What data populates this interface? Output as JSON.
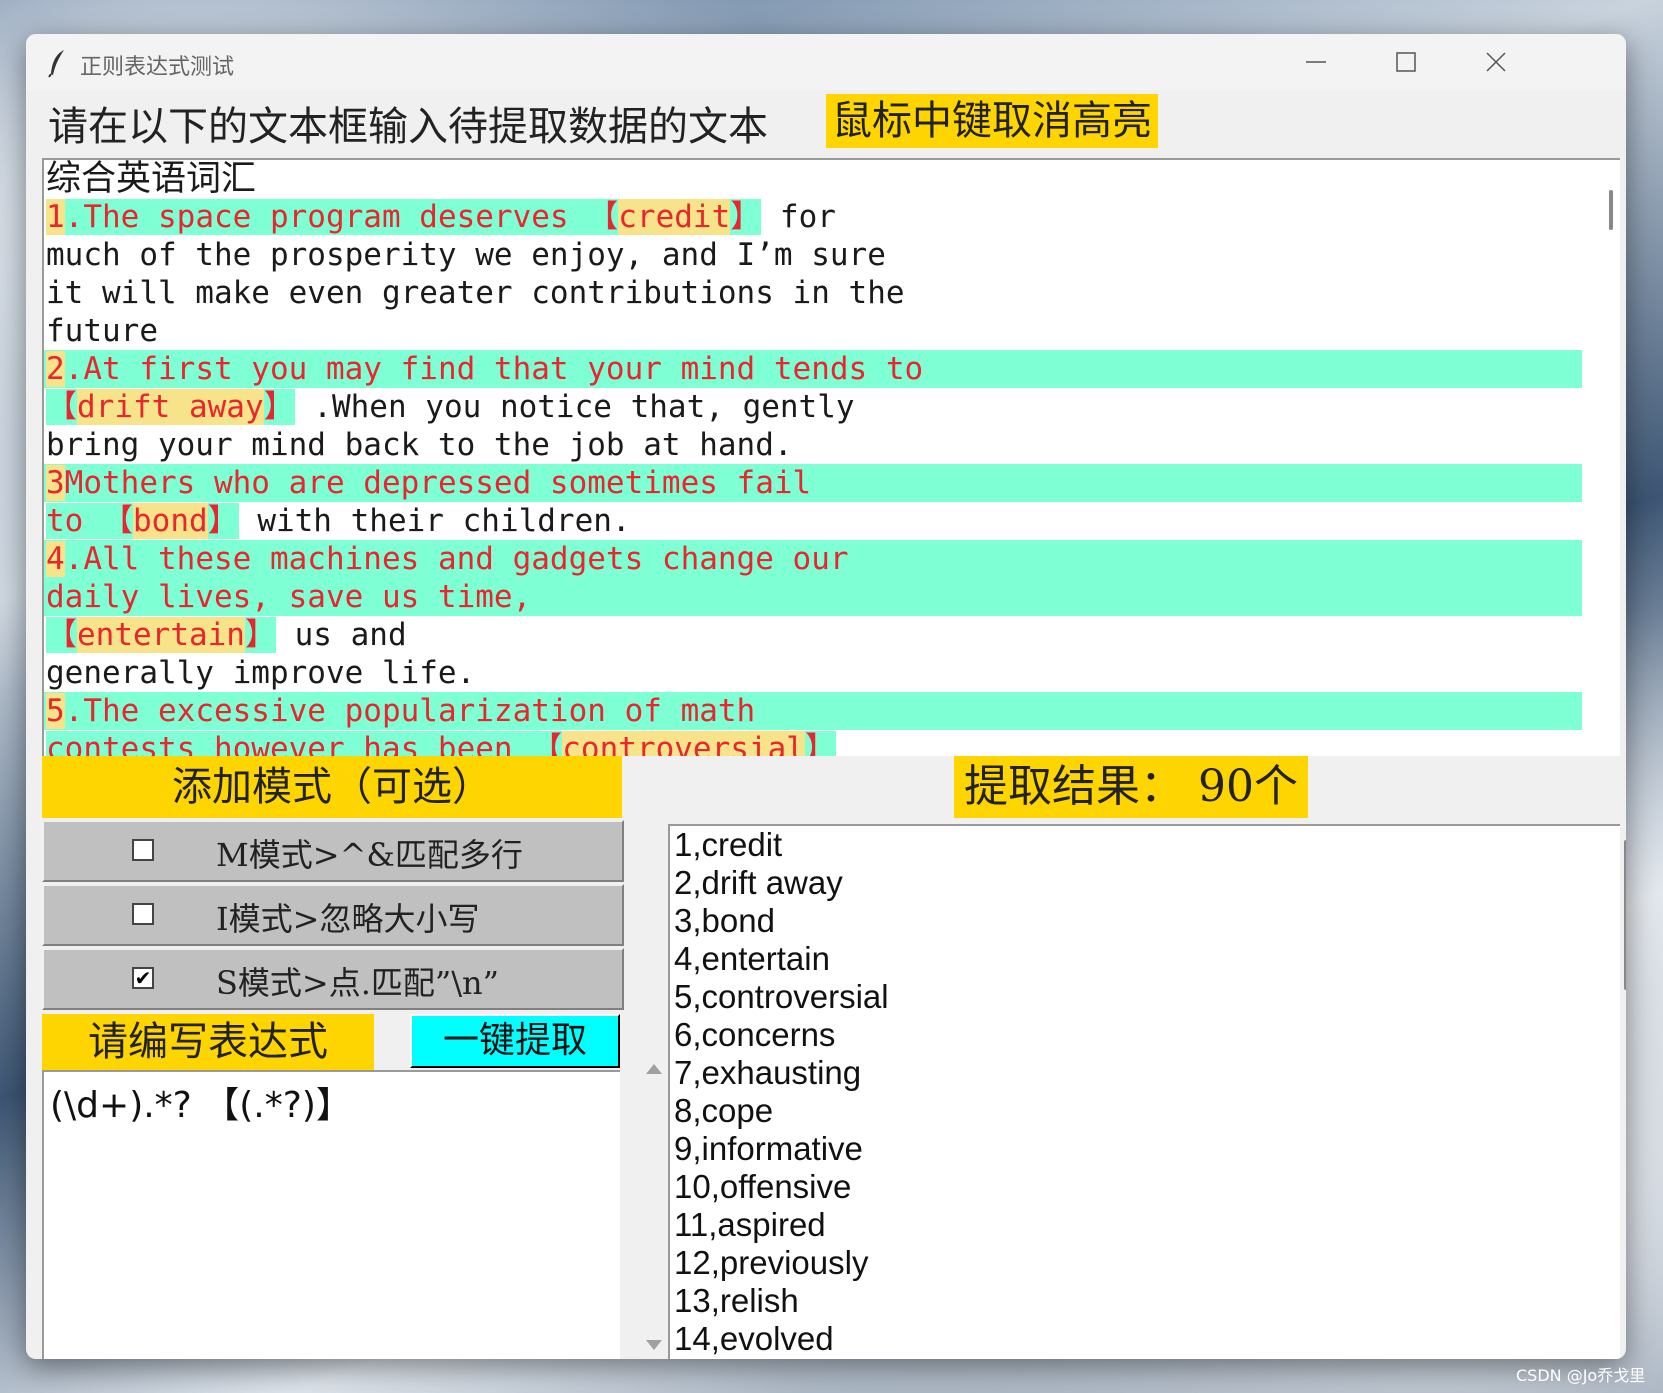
{
  "window": {
    "title": "正则表达式测试"
  },
  "header": {
    "instruction": "请在以下的文本框输入待提取数据的文本",
    "hint": "鼠标中键取消高亮"
  },
  "text_area": {
    "lines": [
      "综合英语词汇",
      "1.The space program deserves 【credit】 for",
      "much of the prosperity we enjoy, and I’m sure",
      "it will make even greater contributions in the",
      "future",
      "2.At first you may find that your mind tends to",
      "【drift away】 .When you notice that, gently",
      "bring your mind back to the job at hand.",
      "3Mothers who are depressed sometimes fail",
      "to 【bond】 with their children.",
      "4.All these machines and gadgets change our",
      "daily lives, save us time,",
      "【entertain】 us and",
      "generally improve life.",
      "5.The excessive popularization of math",
      "contests however has been 【controversial】"
    ]
  },
  "modes": {
    "header": "添加模式（可选）",
    "items": [
      {
        "label": "M模式>^&匹配多行",
        "checked": false
      },
      {
        "label": "I模式>忽略大小写",
        "checked": false
      },
      {
        "label": "S模式>点.匹配”\\n”",
        "checked": true
      }
    ]
  },
  "expression": {
    "label": "请编写表达式",
    "button": "一键提取",
    "value": "(\\d+).*? 【(.*?)】"
  },
  "results": {
    "header": "提取结果： 90个",
    "items": [
      "1,credit",
      "2,drift away",
      "3,bond",
      "4,entertain",
      "5,controversial",
      "6,concerns",
      "7,exhausting",
      "8,cope",
      "9,informative",
      "10,offensive",
      "11,aspired",
      "12,previously",
      "13,relish",
      "14,evolved"
    ]
  },
  "watermark": "CSDN @Jo乔戈里",
  "colors": {
    "accent": "#ffd500",
    "highlight": "#7fffd4",
    "match": "#e8262e",
    "button": "#00ffff"
  }
}
